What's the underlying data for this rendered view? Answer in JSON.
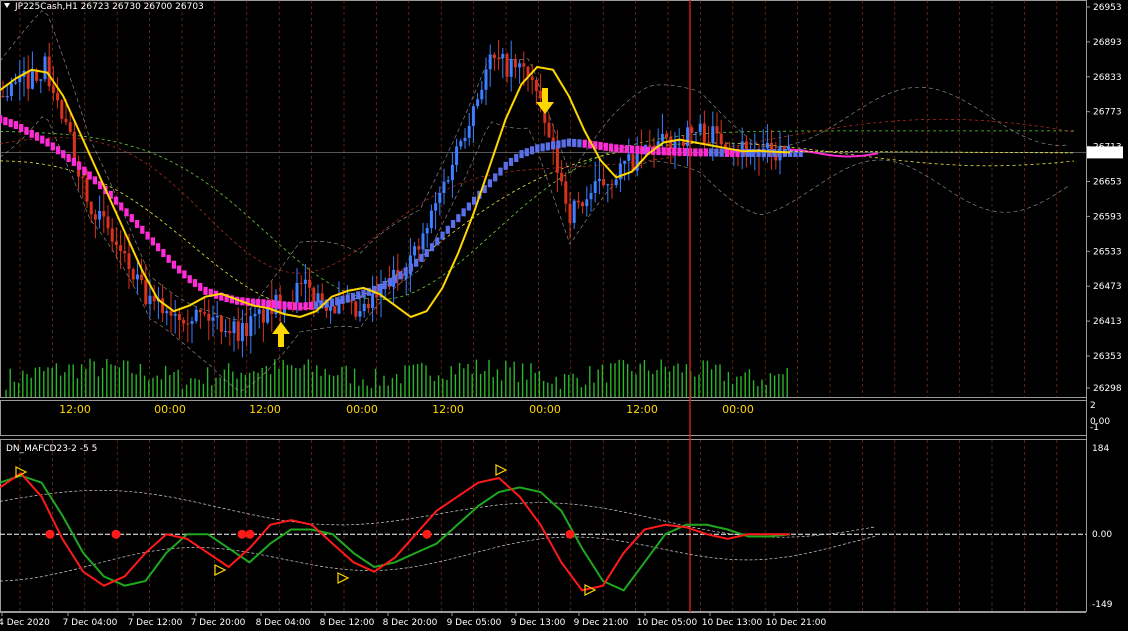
{
  "header": {
    "symbol_info": "JP225Cash,H1  26723 26730 26700 26703"
  },
  "indicator": {
    "title": "DN_MAFCD23-2 -5 5"
  },
  "colors": {
    "bull": "#3d7fff",
    "bear": "#d8331e",
    "yellow": "#ffd700",
    "magenta": "#ff2bd6",
    "blue_band": "#5a6fe8",
    "volume": "#2bb52b",
    "osc_red": "#ff1a1a",
    "osc_green": "#1fa81f",
    "vline": "#d6211b",
    "grid": "#c8501e"
  },
  "chart_data": [
    {
      "type": "line",
      "name": "main",
      "price_axis_labels": [
        "26953",
        "26893",
        "26833",
        "26773",
        "26713",
        "26653",
        "26593",
        "26533",
        "26473",
        "26413",
        "26353",
        "26298"
      ],
      "current_price": "26703",
      "time_labels": [
        "12:00",
        "00:00",
        "12:00",
        "00:00",
        "12:00",
        "00:00",
        "12:00",
        "00:00"
      ],
      "ylim": [
        26298,
        26965
      ],
      "series": [
        {
          "values": [
            26810,
            26830,
            26845,
            26840,
            26800,
            26740,
            26680,
            26620,
            26560,
            26500,
            26450,
            26430,
            26440,
            26455,
            26460,
            26450,
            26440,
            26435,
            26425,
            26420,
            26430,
            26455,
            26465,
            26470,
            26460,
            26440,
            26420,
            26430,
            26470,
            26530,
            26600,
            26680,
            26760,
            26820,
            26850,
            26845,
            26800,
            26740,
            26690,
            26660,
            26670,
            26700,
            26720,
            26725,
            26720,
            26715,
            26710,
            26705,
            26706,
            26704,
            26703
          ]
        },
        {
          "values": [
            26760,
            26750,
            26735,
            26720,
            26700,
            26680,
            26655,
            26630,
            26600,
            26570,
            26540,
            26510,
            26485,
            26465,
            26455,
            26448,
            26445,
            26443,
            26440,
            26438,
            26440,
            26445,
            26452,
            26460,
            26470,
            26485,
            26505,
            26530,
            26560,
            26590,
            26620,
            26650,
            26680,
            26700,
            26710,
            26715,
            26720,
            26718,
            26714,
            26710,
            26708,
            26706,
            26705,
            26704,
            26703,
            26703,
            26702,
            26702,
            26702,
            26702,
            26702
          ]
        }
      ]
    },
    {
      "type": "bar",
      "name": "stoch",
      "axis_labels": [
        "2",
        "0.00",
        "-1"
      ],
      "values": [
        2,
        0,
        -1
      ]
    },
    {
      "type": "line",
      "name": "DN_MAFCD23-2",
      "axis_labels": [
        "184",
        "0.00",
        "-149"
      ],
      "x_labels": [
        "4 Dec 2020",
        "7 Dec 04:00",
        "7 Dec 12:00",
        "7 Dec 20:00",
        "8 Dec 04:00",
        "8 Dec 12:00",
        "8 Dec 20:00",
        "9 Dec 05:00",
        "9 Dec 13:00",
        "9 Dec 21:00",
        "10 Dec 05:00",
        "10 Dec 13:00",
        "10 Dec 21:00"
      ],
      "ylim": [
        -149,
        184
      ],
      "series": [
        {
          "values": [
            110,
            125,
            110,
            40,
            -40,
            -90,
            -110,
            -100,
            -40,
            0,
            0,
            -30,
            -60,
            -20,
            10,
            10,
            0,
            -40,
            -70,
            -60,
            -40,
            -20,
            20,
            60,
            90,
            100,
            90,
            50,
            -30,
            -100,
            -120,
            -60,
            0,
            20,
            20,
            10,
            -5,
            -5,
            0
          ]
        },
        {
          "values": [
            100,
            130,
            80,
            -10,
            -80,
            -110,
            -90,
            -40,
            0,
            -10,
            -40,
            -70,
            -30,
            20,
            30,
            20,
            -20,
            -60,
            -80,
            -50,
            0,
            50,
            80,
            110,
            120,
            80,
            20,
            -60,
            -120,
            -110,
            -40,
            10,
            20,
            15,
            0,
            -10,
            0,
            0,
            0
          ]
        }
      ]
    }
  ]
}
